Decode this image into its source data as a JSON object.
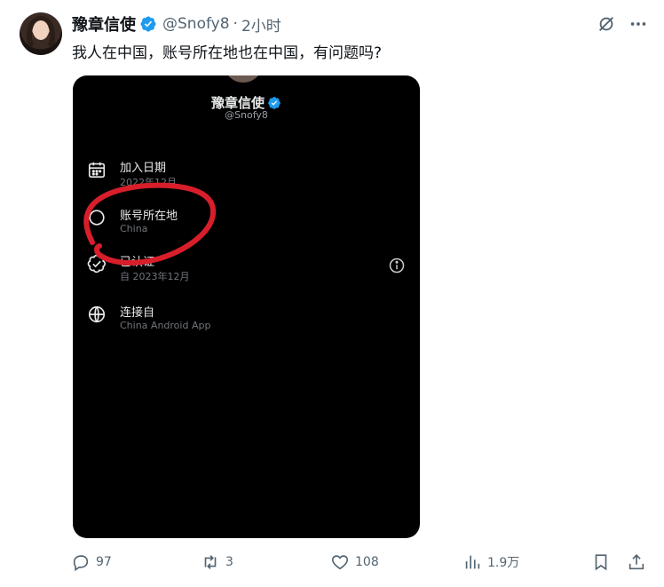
{
  "tweet": {
    "display_name": "豫章信使",
    "handle": "@Snofy8",
    "separator": "·",
    "time": "2小时",
    "text": "我人在中国，账号所在地也在中国，有问题吗?"
  },
  "media": {
    "profile_name": "豫章信使",
    "profile_handle": "@Snofy8",
    "rows": [
      {
        "icon": "calendar-icon",
        "title": "加入日期",
        "sub": "2022年12月"
      },
      {
        "icon": "location-icon",
        "title": "账号所在地",
        "sub": "China"
      },
      {
        "icon": "verified-check-icon",
        "title": "已认证",
        "sub": "自 2023年12月"
      },
      {
        "icon": "globe-icon",
        "title": "连接自",
        "sub": "China Android App"
      }
    ],
    "annotation_color": "#d81e2a"
  },
  "actions": {
    "replies": "97",
    "retweets": "3",
    "likes": "108",
    "views": "1.9万"
  },
  "colors": {
    "verified": "#1d9bf0",
    "muted": "#536471",
    "text": "#0f1419",
    "media_bg": "#000000"
  }
}
